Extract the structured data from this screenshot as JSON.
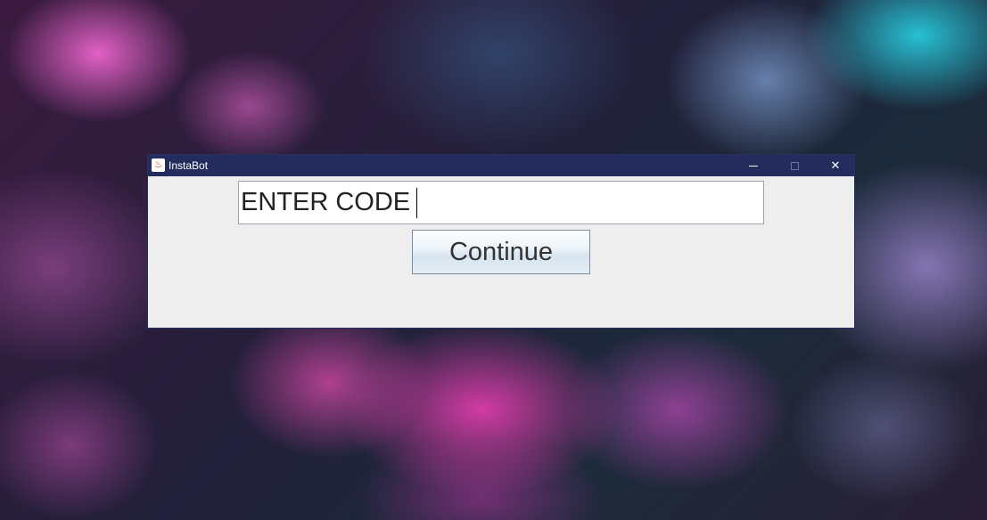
{
  "window": {
    "title": "InstaBot",
    "app_icon": "java-cup-icon"
  },
  "controls": {
    "minimize_icon": "minimize-icon",
    "maximize_icon": "maximize-icon",
    "close_icon": "close-icon",
    "close_glyph": "✕"
  },
  "form": {
    "code_value": "ENTER CODE",
    "continue_label": "Continue"
  },
  "colors": {
    "titlebar": "#242c5e",
    "window_bg": "#eeeeee"
  }
}
